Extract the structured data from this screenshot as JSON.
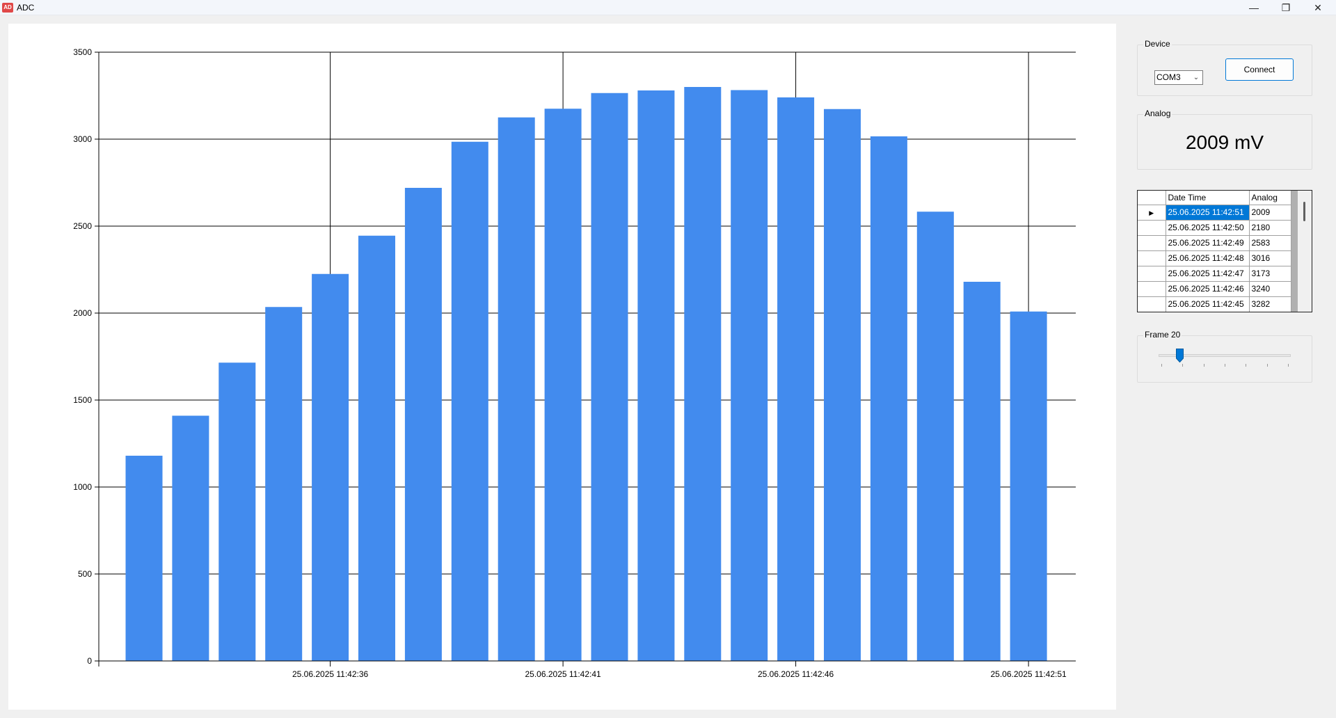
{
  "window": {
    "title": "ADC",
    "icon_text": "AD",
    "controls": [
      "minimize-icon",
      "restore-icon",
      "close-icon"
    ]
  },
  "device": {
    "label": "Device",
    "port": "COM3",
    "connect_label": "Connect"
  },
  "analog": {
    "label": "Analog",
    "value": "2009 mV"
  },
  "grid": {
    "columns": [
      "Date Time",
      "Analog"
    ],
    "rows": [
      {
        "datetime": "25.06.2025 11:42:51",
        "value": "2009"
      },
      {
        "datetime": "25.06.2025 11:42:50",
        "value": "2180"
      },
      {
        "datetime": "25.06.2025 11:42:49",
        "value": "2583"
      },
      {
        "datetime": "25.06.2025 11:42:48",
        "value": "3016"
      },
      {
        "datetime": "25.06.2025 11:42:47",
        "value": "3173"
      },
      {
        "datetime": "25.06.2025 11:42:46",
        "value": "3240"
      },
      {
        "datetime": "25.06.2025 11:42:45",
        "value": "3282"
      }
    ]
  },
  "frame": {
    "label": "Frame 20",
    "slider_value": 20,
    "slider_min": 5,
    "slider_max": 100
  },
  "colors": {
    "bar": "#428bee",
    "accent": "#0078d7"
  },
  "chart_data": {
    "type": "bar",
    "x": [
      "25.06.2025 11:42:32",
      "25.06.2025 11:42:33",
      "25.06.2025 11:42:34",
      "25.06.2025 11:42:35",
      "25.06.2025 11:42:36",
      "25.06.2025 11:42:37",
      "25.06.2025 11:42:38",
      "25.06.2025 11:42:39",
      "25.06.2025 11:42:40",
      "25.06.2025 11:42:41",
      "25.06.2025 11:42:42",
      "25.06.2025 11:42:43",
      "25.06.2025 11:42:44",
      "25.06.2025 11:42:45",
      "25.06.2025 11:42:46",
      "25.06.2025 11:42:47",
      "25.06.2025 11:42:48",
      "25.06.2025 11:42:49",
      "25.06.2025 11:42:50",
      "25.06.2025 11:42:51"
    ],
    "values": [
      1180,
      1410,
      1715,
      2035,
      2225,
      2445,
      2720,
      2985,
      3125,
      3175,
      3265,
      3280,
      3300,
      3282,
      3240,
      3173,
      3016,
      2583,
      2180,
      2009
    ],
    "x_tick_labels": [
      "25.06.2025 11:42:36",
      "25.06.2025 11:42:41",
      "25.06.2025 11:42:46",
      "25.06.2025 11:42:51"
    ],
    "y_ticks": [
      0,
      500,
      1000,
      1500,
      2000,
      2500,
      3000,
      3500
    ],
    "ylim": [
      0,
      3500
    ],
    "grid": true,
    "legend": false,
    "title": "",
    "xlabel": "",
    "ylabel": ""
  }
}
